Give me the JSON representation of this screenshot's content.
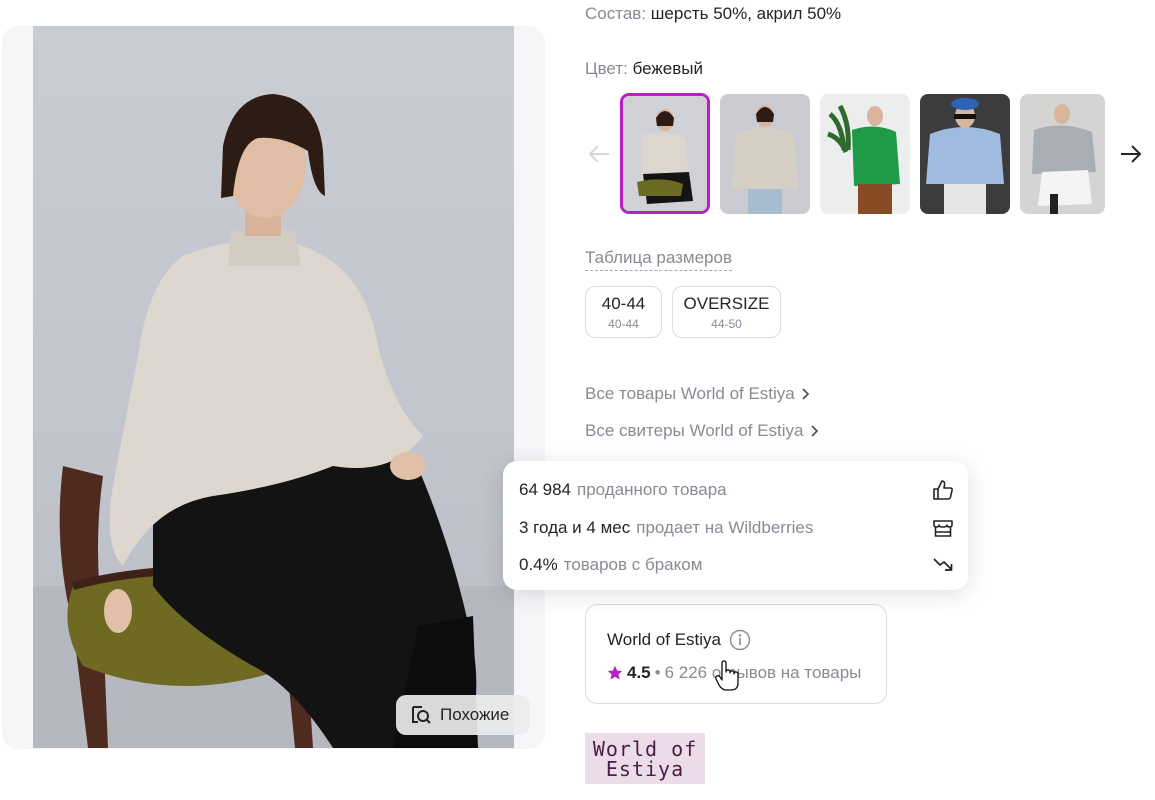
{
  "product": {
    "composition_label": "Состав:",
    "composition_value": "шерсть 50%, акрил 50%",
    "color_label": "Цвет:",
    "color_value": "бежевый",
    "similar_button": "Похожие",
    "color_variants": [
      {
        "name": "beige-sweater-on-chair",
        "active": true
      },
      {
        "name": "beige-sweater-front",
        "active": false
      },
      {
        "name": "green-sweater-with-plant",
        "active": false
      },
      {
        "name": "blue-sweater-with-beret",
        "active": false
      },
      {
        "name": "grey-sweater-on-chair",
        "active": false
      }
    ]
  },
  "sizes": {
    "table_link": "Таблица размеров",
    "items": [
      {
        "label": "40-44",
        "sub": "40-44"
      },
      {
        "label": "OVERSIZE",
        "sub": "44-50"
      }
    ]
  },
  "links": {
    "all_products": "Все товары World of Estiya",
    "all_sweaters": "Все свитеры World of Estiya"
  },
  "seller_stats": {
    "sold_value": "64 984",
    "sold_label": "проданного товара",
    "tenure_value": "3 года и 4 мес",
    "tenure_label": "продает на Wildberries",
    "defect_value": "0.4%",
    "defect_label": "товаров с браком"
  },
  "seller": {
    "name": "World of Estiya",
    "rating": "4.5",
    "separator": "•",
    "reviews": "6 226 отзывов на товары",
    "logo_line1": "World of",
    "logo_line2": "Estiya"
  },
  "colors": {
    "accent": "#b620c4",
    "text_primary": "#242424",
    "text_muted": "#8a8a97",
    "border": "#dcdce3",
    "logo_bg": "#ecdce9"
  }
}
